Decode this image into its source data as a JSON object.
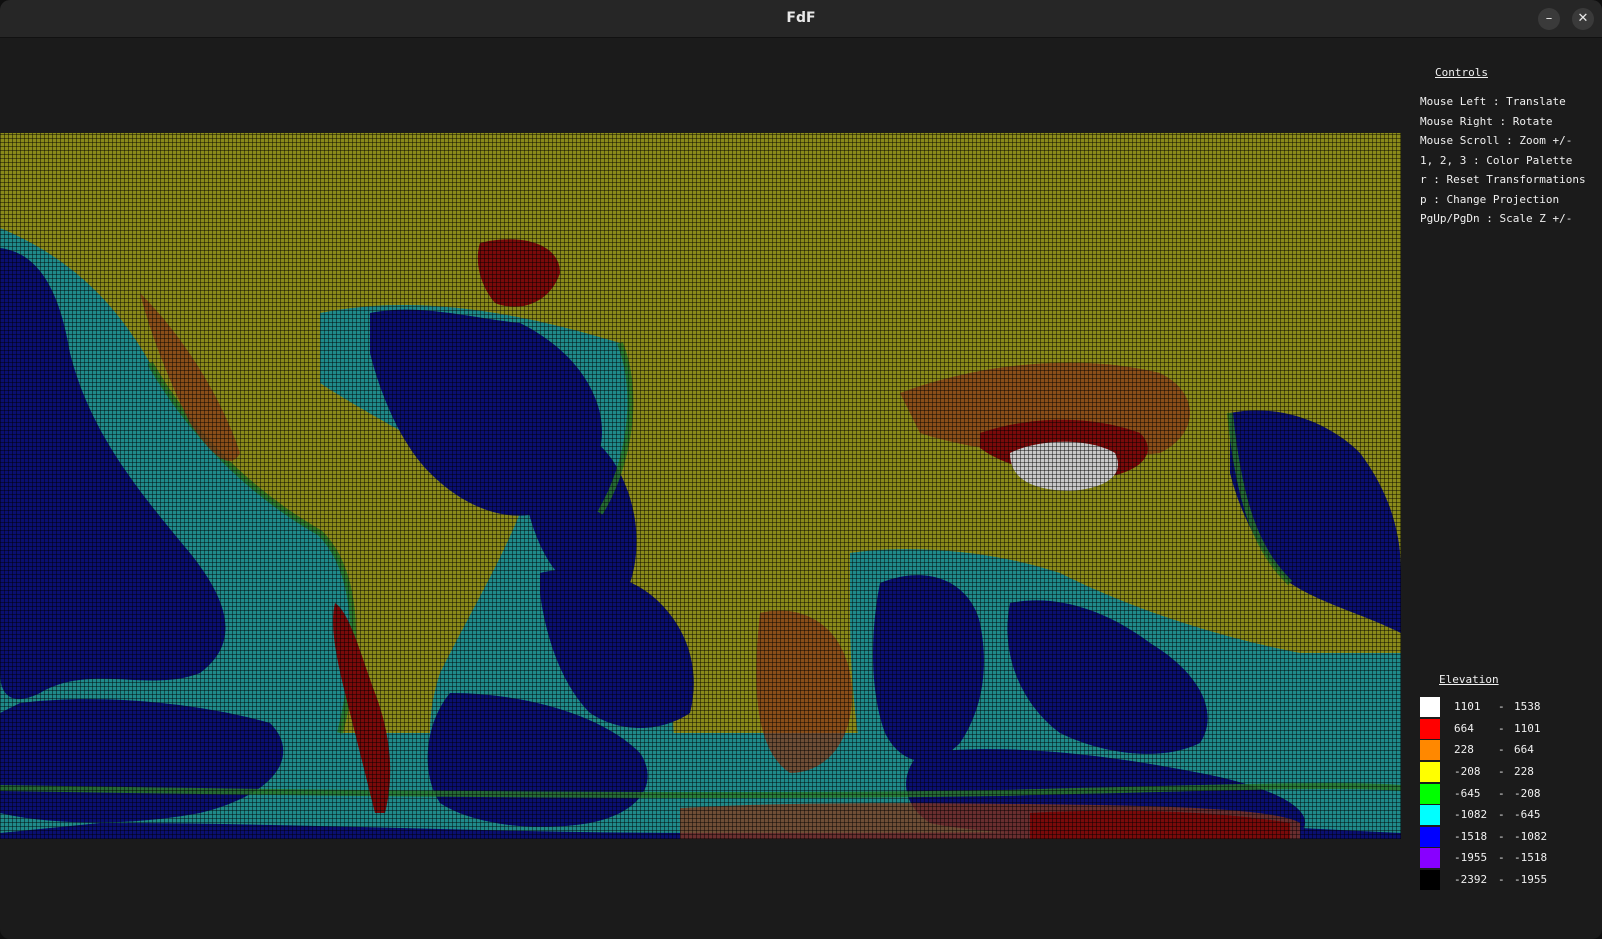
{
  "window": {
    "title": "FdF",
    "minimize_label": "–",
    "close_label": "✕"
  },
  "controls": {
    "title": "Controls",
    "items": [
      "Mouse Left : Translate",
      "Mouse Right : Rotate",
      "Mouse Scroll : Zoom +/-",
      "1, 2, 3 : Color Palette",
      "r : Reset Transformations",
      "p : Change Projection",
      "PgUp/PgDn : Scale Z +/-"
    ]
  },
  "legend": {
    "title": "Elevation",
    "separator": "-",
    "rows": [
      {
        "low": "1101",
        "high": "1538",
        "color": "#ffffff"
      },
      {
        "low": "664",
        "high": "1101",
        "color": "#ff0000"
      },
      {
        "low": "228",
        "high": "664",
        "color": "#ff8800"
      },
      {
        "low": "-208",
        "high": "228",
        "color": "#ffff00"
      },
      {
        "low": "-645",
        "high": "-208",
        "color": "#00ff00"
      },
      {
        "low": "-1082",
        "high": "-645",
        "color": "#00ffff"
      },
      {
        "low": "-1518",
        "high": "-1082",
        "color": "#0000ff"
      },
      {
        "low": "-1955",
        "high": "-1518",
        "color": "#8800ff"
      },
      {
        "low": "-2392",
        "high": "-1955",
        "color": "#000000"
      }
    ]
  },
  "map": {
    "colors": {
      "ocean_deep": "#0a0f70",
      "ocean_shelf": "#1f8a8a",
      "land_low": "#8a8a1a",
      "land_mid": "#8a3a1a",
      "land_high": "#7a0a0a",
      "peak": "#c8c8c8",
      "coast": "#2a7a2a"
    }
  }
}
